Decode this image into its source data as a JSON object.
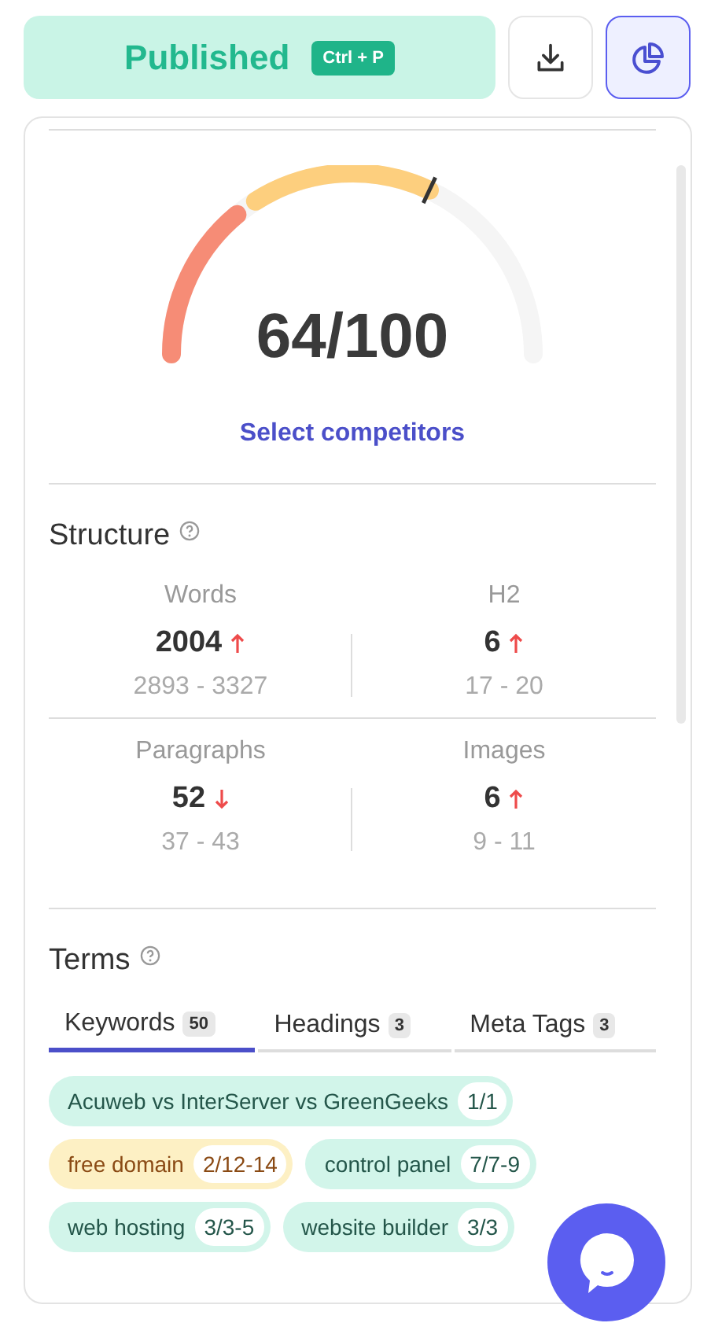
{
  "toolbar": {
    "publish": {
      "label": "Published",
      "shortcut": "Ctrl + P"
    },
    "chart_button": {
      "selected": true
    }
  },
  "score": {
    "text": "64/100",
    "link": "Select competitors"
  },
  "structure": {
    "title": "Structure",
    "metrics": [
      {
        "label": "Words",
        "value": "2004",
        "kind": "up",
        "range": "2893 - 3327"
      },
      {
        "label": "H2",
        "value": "6",
        "kind": "up",
        "range": "17 - 20"
      },
      {
        "label": "Paragraphs",
        "value": "52",
        "kind": "down",
        "range": "37 - 43"
      },
      {
        "label": "Images",
        "value": "6",
        "kind": "up",
        "range": "9 - 11"
      }
    ]
  },
  "terms": {
    "title": "Terms",
    "tabs": [
      {
        "label": "Keywords",
        "count": "50",
        "selected": true
      },
      {
        "label": "Headings",
        "count": "3",
        "selected": false
      },
      {
        "label": "Meta Tags",
        "count": "3",
        "selected": false
      }
    ],
    "chips": [
      {
        "text": "Acuweb vs InterServer vs GreenGeeks",
        "count": "1/1",
        "color": "#d2f5ea"
      },
      {
        "text": "free domain",
        "count": "2/12-14",
        "color": "#fdf0c4"
      },
      {
        "text": "control panel",
        "count": "7/7-9",
        "color": "#d2f5ea"
      },
      {
        "text": "web hosting",
        "count": "3/3-5",
        "color": "#d2f5ea"
      },
      {
        "text": "website builder",
        "count": "3/3",
        "color": "#d2f5ea"
      }
    ]
  }
}
